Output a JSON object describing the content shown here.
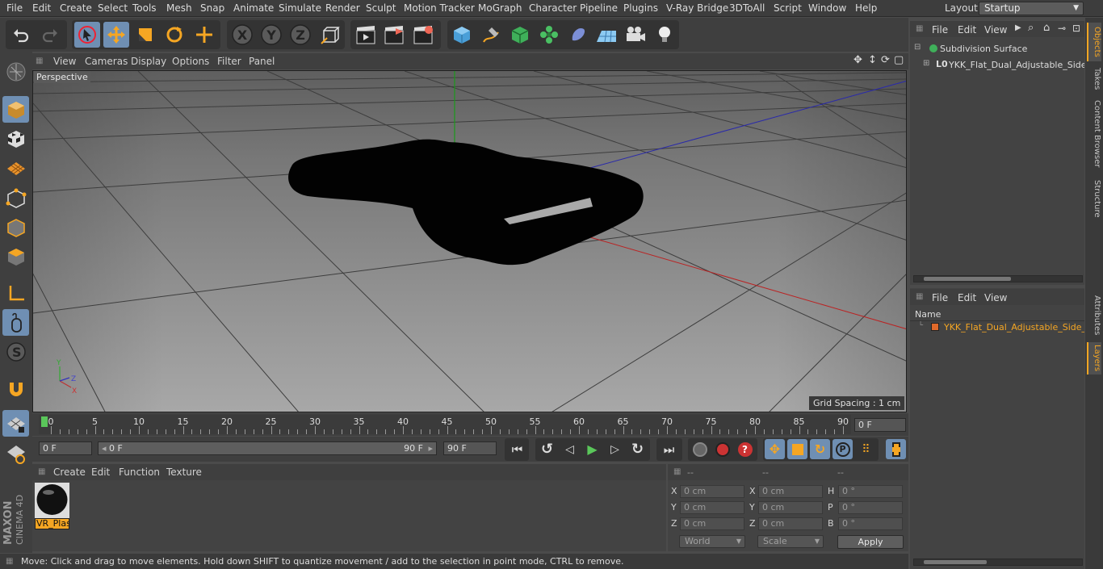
{
  "menubar": {
    "items": [
      "File",
      "Edit",
      "Create",
      "Select",
      "Tools",
      "Mesh",
      "Snap",
      "Animate",
      "Simulate",
      "Render",
      "Sculpt",
      "Motion Tracker",
      "MoGraph",
      "Character",
      "Pipeline",
      "Plugins",
      "V-Ray Bridge",
      "3DToAll",
      "Script",
      "Window",
      "Help"
    ],
    "layout_label": "Layout:",
    "layout_value": "Startup"
  },
  "toolbar": {
    "axis_x": "X",
    "axis_y": "Y",
    "axis_z": "Z"
  },
  "viewport": {
    "menu": [
      "View",
      "Cameras",
      "Display",
      "Options",
      "Filter",
      "Panel"
    ],
    "camera_label": "Perspective",
    "grid_spacing": "Grid Spacing : 1 cm",
    "axis_labels": {
      "x": "X",
      "y": "Y",
      "z": "Z"
    }
  },
  "timeline": {
    "ticks": [
      "0",
      "5",
      "10",
      "15",
      "20",
      "25",
      "30",
      "35",
      "40",
      "45",
      "50",
      "55",
      "60",
      "65",
      "70",
      "75",
      "80",
      "85",
      "90"
    ],
    "current_frame": "0 F"
  },
  "transport": {
    "start_field": "0 F",
    "range_start": "0 F",
    "range_end": "90 F",
    "end_field": "90 F"
  },
  "materials": {
    "menu": [
      "Create",
      "Edit",
      "Function",
      "Texture"
    ],
    "items": [
      {
        "name": "VR_Plast"
      }
    ]
  },
  "coords": {
    "headers": [
      "--",
      "--",
      "--"
    ],
    "rows": [
      {
        "l1": "X",
        "v1": "0 cm",
        "l2": "X",
        "v2": "0 cm",
        "l3": "H",
        "v3": "0 °"
      },
      {
        "l1": "Y",
        "v1": "0 cm",
        "l2": "Y",
        "v2": "0 cm",
        "l3": "P",
        "v3": "0 °"
      },
      {
        "l1": "Z",
        "v1": "0 cm",
        "l2": "Z",
        "v2": "0 cm",
        "l3": "B",
        "v3": "0 °"
      }
    ],
    "mode_world": "World",
    "mode_scale": "Scale",
    "apply": "Apply"
  },
  "status": {
    "text": "Move: Click and drag to move elements. Hold down SHIFT to quantize movement / add to the selection in point mode, CTRL to remove."
  },
  "objects": {
    "menu": [
      "File",
      "Edit",
      "View"
    ],
    "items": [
      {
        "name": "Subdivision Surface"
      },
      {
        "name": "YKK_Flat_Dual_Adjustable_Side_R"
      }
    ]
  },
  "layers": {
    "menu": [
      "File",
      "Edit",
      "View"
    ],
    "column_header": "Name",
    "items": [
      {
        "name": "YKK_Flat_Dual_Adjustable_Side_Re",
        "color": "#e0692a"
      }
    ]
  },
  "side_tabs": [
    "Objects",
    "Takes",
    "Content Browser",
    "Structure",
    "Attributes",
    "Layers"
  ],
  "colors": {
    "accent": "#f5a623",
    "selected_tool": "#6f8fb3"
  }
}
